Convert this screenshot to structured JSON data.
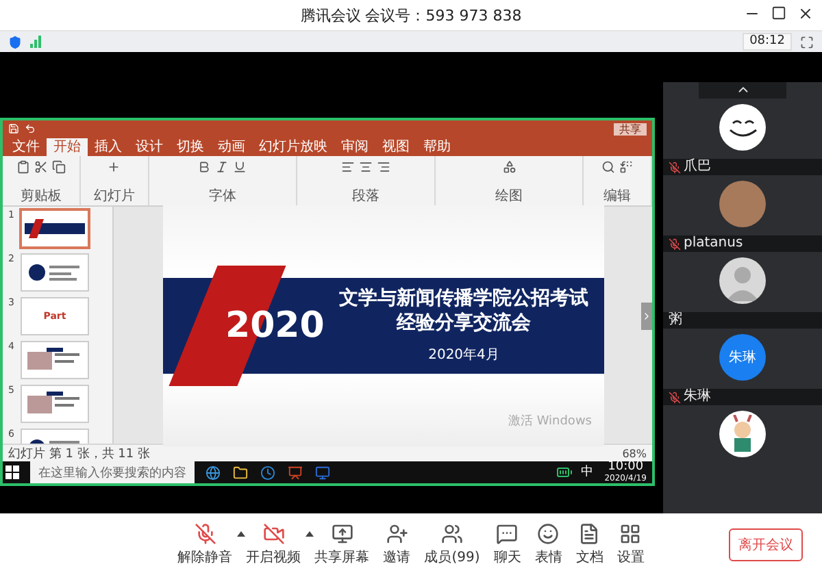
{
  "window": {
    "title": "腾讯会议 会议号：593 973 838"
  },
  "info_bar": {
    "timer": "08:12"
  },
  "shared_screen": {
    "ppt_share_button": "共享",
    "ribbon_tabs": [
      {
        "label": "文件",
        "selected": false
      },
      {
        "label": "开始",
        "selected": true
      },
      {
        "label": "插入",
        "selected": false
      },
      {
        "label": "设计",
        "selected": false
      },
      {
        "label": "切换",
        "selected": false
      },
      {
        "label": "动画",
        "selected": false
      },
      {
        "label": "幻灯片放映",
        "selected": false
      },
      {
        "label": "审阅",
        "selected": false
      },
      {
        "label": "视图",
        "selected": false
      },
      {
        "label": "帮助",
        "selected": false
      }
    ],
    "ribbon_groups": [
      {
        "label": "剪贴板",
        "kind": "clipboard"
      },
      {
        "label": "幻灯片",
        "kind": "slides"
      },
      {
        "label": "字体",
        "kind": "font"
      },
      {
        "label": "段落",
        "kind": "paragraph"
      },
      {
        "label": "绘图",
        "kind": "drawing"
      },
      {
        "label": "编辑",
        "kind": "editing"
      }
    ],
    "thumbnails": [
      {
        "number": "1",
        "selected": true,
        "kind": "title"
      },
      {
        "number": "2",
        "selected": false,
        "kind": "agenda"
      },
      {
        "number": "3",
        "selected": false,
        "kind": "part",
        "caption": "Part"
      },
      {
        "number": "4",
        "selected": false,
        "kind": "photos"
      },
      {
        "number": "5",
        "selected": false,
        "kind": "photos"
      },
      {
        "number": "6",
        "selected": false,
        "kind": "agenda"
      }
    ],
    "slide": {
      "year": "2020",
      "title_lines": [
        "文学与新闻传播学院公招考试",
        "经验分享交流会"
      ],
      "date": "2020年4月"
    },
    "activation_notice": "激活 Windows",
    "status_bar": {
      "slide_info": "幻灯片 第 1 张，共 11 张",
      "zoom": "68%"
    },
    "taskbar": {
      "search_placeholder": "在这里输入你要搜索的内容",
      "ime": "中",
      "time": "10:00",
      "date": "2020/4/19"
    }
  },
  "participants": [
    {
      "name": "爪巴",
      "kind": "cartoon",
      "muted": true
    },
    {
      "name": "platanus",
      "kind": "photo",
      "muted": true
    },
    {
      "name": "粥",
      "kind": "silhouette",
      "muted": false
    },
    {
      "name": "朱琳",
      "kind": "initials",
      "initials": "朱琳",
      "muted": true
    },
    {
      "kind": "sticker"
    }
  ],
  "toolbar": {
    "items": [
      {
        "label": "解除静音",
        "kind": "mic_off",
        "caret": true
      },
      {
        "label": "开启视频",
        "kind": "video_off",
        "caret": true
      },
      {
        "label": "共享屏幕",
        "kind": "share",
        "caret": false
      },
      {
        "label": "邀请",
        "kind": "invite",
        "caret": false
      },
      {
        "label": "成员(99)",
        "kind": "members",
        "caret": false
      },
      {
        "label": "聊天",
        "kind": "chat",
        "caret": false
      },
      {
        "label": "表情",
        "kind": "emoji",
        "caret": false
      },
      {
        "label": "文档",
        "kind": "docs",
        "caret": false
      },
      {
        "label": "设置",
        "kind": "settings",
        "caret": false
      }
    ],
    "leave_button": "离开会议"
  }
}
